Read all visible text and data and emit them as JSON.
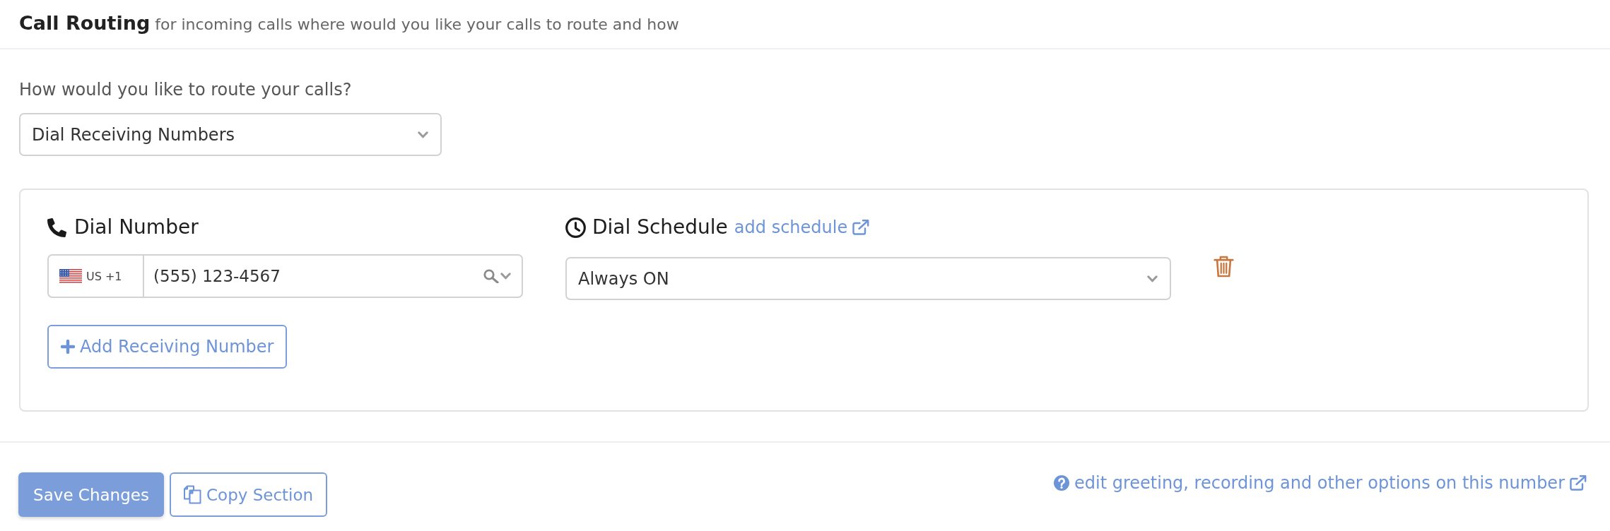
{
  "header": {
    "title": "Call Routing",
    "subtitle": "for incoming calls where would you like your calls to route and how"
  },
  "routing": {
    "label": "How would you like to route your calls?",
    "selected_option": "Dial Receiving Numbers"
  },
  "receivers": [
    {
      "number_label": "Dial Number",
      "country_code": "US +1",
      "phone_number": "(555) 123-4567",
      "schedule_label": "Dial Schedule",
      "schedule_link": "add schedule",
      "schedule": "Always ON"
    }
  ],
  "add_receiver_button": "Add Receiving Number",
  "footer": {
    "buttons": [
      {
        "kind": "primary",
        "label": "Save Changes"
      },
      {
        "kind": "copy",
        "label": "Copy Section"
      }
    ],
    "help_link": "edit greeting, recording and other options on this number"
  }
}
